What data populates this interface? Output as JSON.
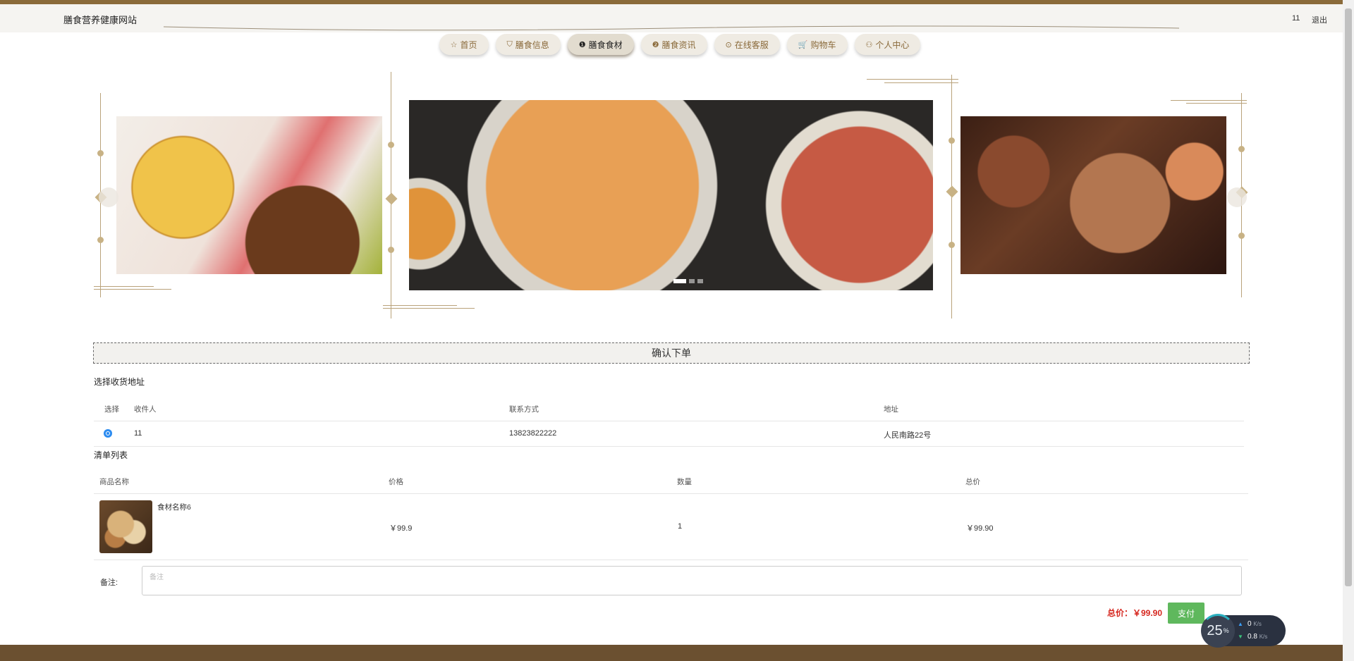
{
  "header": {
    "site_title": "膳食营养健康网站",
    "user": "11",
    "logout": "退出"
  },
  "nav": {
    "items": [
      {
        "icon": "☆",
        "label": "首页",
        "active": false
      },
      {
        "icon": "⛉",
        "label": "膳食信息",
        "active": false
      },
      {
        "icon": "❶",
        "label": "膳食食材",
        "active": true
      },
      {
        "icon": "❷",
        "label": "膳食资讯",
        "active": false
      },
      {
        "icon": "⊙",
        "label": "在线客服",
        "active": false
      },
      {
        "icon": "🛒",
        "label": "购物车",
        "active": false
      },
      {
        "icon": "⚇",
        "label": "个人中心",
        "active": false
      }
    ]
  },
  "carousel": {
    "active_index": 1,
    "slide_count": 3
  },
  "order": {
    "confirm_title": "确认下单",
    "address_section_title": "选择收货地址",
    "address_headers": {
      "select": "选择",
      "recipient": "收件人",
      "contact": "联系方式",
      "address": "地址"
    },
    "address_rows": [
      {
        "recipient": "11",
        "contact": "13823822222",
        "address": "人民南路22号",
        "selected": true
      }
    ],
    "list_section_title": "清单列表",
    "list_headers": {
      "name": "商品名称",
      "price": "价格",
      "qty": "数量",
      "total": "总价"
    },
    "items": [
      {
        "name": "食材名称6",
        "price": "￥99.9",
        "qty": "1",
        "total": "￥99.90"
      }
    ],
    "remark_label": "备注:",
    "remark_placeholder": "备注",
    "remark_value": "",
    "total_label": "总价：￥99.90",
    "pay_label": "支付"
  },
  "net_widget": {
    "percent": "25",
    "percent_unit": "%",
    "up_value": "0",
    "up_unit": "K/s",
    "down_value": "0.8",
    "down_unit": "K/s"
  },
  "colors": {
    "brand_brown": "#8a6a3a",
    "accent_gold": "#c8b285",
    "total_red": "#d6271f",
    "pay_green": "#5fb85d",
    "radio_blue": "#2d8cf0"
  }
}
